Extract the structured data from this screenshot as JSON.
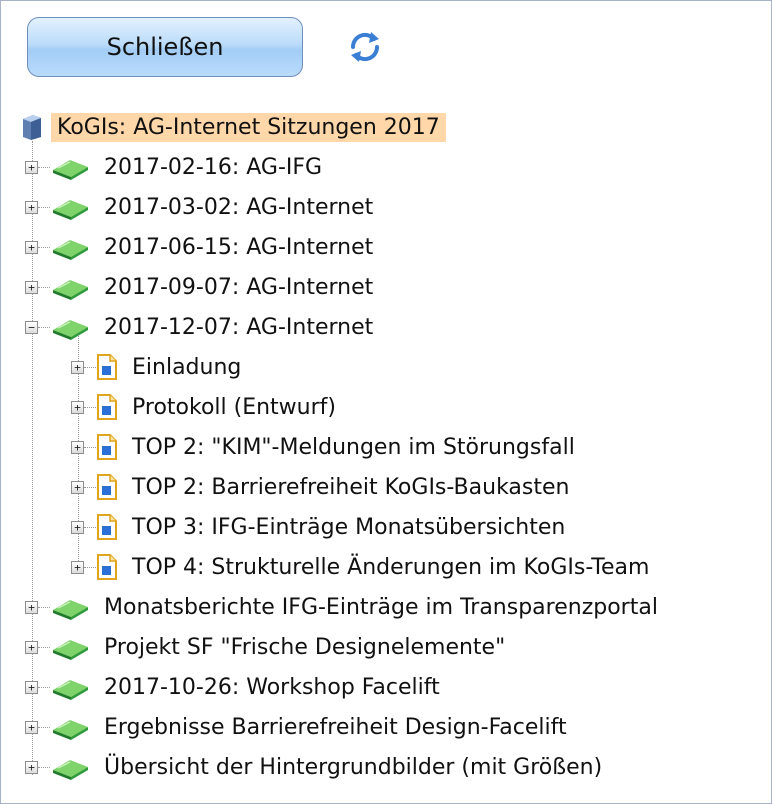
{
  "toolbar": {
    "close_label": "Schließen",
    "refresh_icon": "refresh-icon"
  },
  "tree": {
    "root": {
      "label": "KoGIs: AG-Internet Sitzungen 2017",
      "icon": "database-icon",
      "selected": true
    },
    "folders_before": [
      {
        "label": "2017-02-16: AG-IFG",
        "expanded": false
      },
      {
        "label": "2017-03-02: AG-Internet",
        "expanded": false
      },
      {
        "label": "2017-06-15: AG-Internet",
        "expanded": false
      },
      {
        "label": "2017-09-07: AG-Internet",
        "expanded": false
      }
    ],
    "open_folder": {
      "label": "2017-12-07: AG-Internet",
      "expanded": true,
      "documents": [
        {
          "label": "Einladung"
        },
        {
          "label": "Protokoll (Entwurf)"
        },
        {
          "label": "TOP 2: \"KIM\"-Meldungen im Störungsfall"
        },
        {
          "label": "TOP 2: Barrierefreiheit KoGIs-Baukasten"
        },
        {
          "label": "TOP 3: IFG-Einträge Monatsübersichten"
        },
        {
          "label": "TOP 4: Strukturelle Änderungen im KoGIs-Team"
        }
      ]
    },
    "folders_after": [
      {
        "label": "Monatsberichte IFG-Einträge im Transparenzportal",
        "expanded": false
      },
      {
        "label": "Projekt SF \"Frische Designelemente\"",
        "expanded": false
      },
      {
        "label": "2017-10-26: Workshop Facelift",
        "expanded": false
      },
      {
        "label": "Ergebnisse Barrierefreiheit Design-Facelift",
        "expanded": false
      },
      {
        "label": "Übersicht der Hintergrundbilder (mit Größen)",
        "expanded": false
      }
    ]
  },
  "colors": {
    "selection": "#ffd7a8",
    "button_top": "#e3f1ff",
    "button_bottom": "#a3cdf6",
    "folder_green": "#2f9a3a",
    "doc_yellow": "#f2c33a",
    "doc_blue": "#2a6fd6"
  }
}
